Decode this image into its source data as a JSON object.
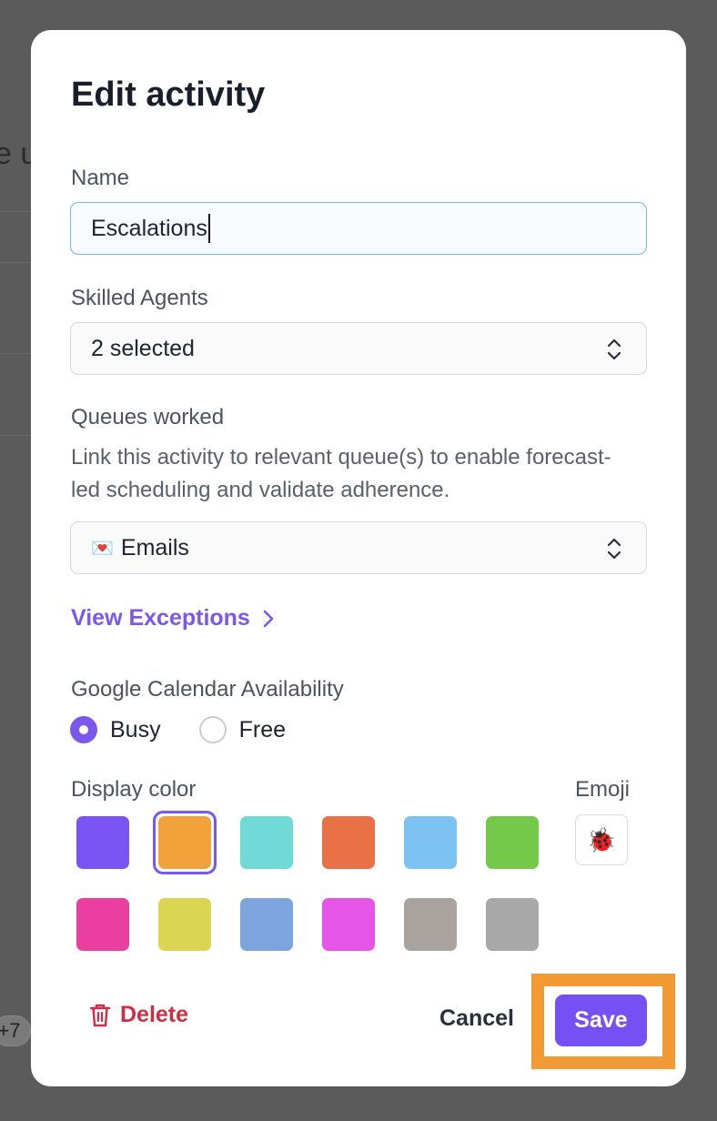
{
  "background": {
    "partial_text": "e u",
    "pill_text": "+7"
  },
  "modal": {
    "title": "Edit activity",
    "name": {
      "label": "Name",
      "value": "Escalations"
    },
    "skilled_agents": {
      "label": "Skilled Agents",
      "value": "2 selected"
    },
    "queues": {
      "label": "Queues worked",
      "help": "Link this activity to relevant queue(s) to enable forecast-led scheduling and validate adherence.",
      "value_emoji": "💌",
      "value": "Emails"
    },
    "view_exceptions": "View Exceptions",
    "availability": {
      "label": "Google Calendar Availability",
      "options": [
        "Busy",
        "Free"
      ],
      "selected": "Busy"
    },
    "display_color": {
      "label": "Display color",
      "selected": "#f2a23a",
      "colors_row1": [
        "#7a55f3",
        "#f2a23a",
        "#6fdad6",
        "#e87146",
        "#7cc3f3",
        "#75c94a"
      ],
      "colors_row2": [
        "#ea3ea0",
        "#dcd553",
        "#7ca4dd",
        "#e555e8",
        "#a9a3a0",
        "#a8a8a8"
      ]
    },
    "emoji": {
      "label": "Emoji",
      "value": "🐞"
    },
    "footer": {
      "delete_label": "Delete",
      "cancel_label": "Cancel",
      "save_label": "Save"
    },
    "accent": "#7b57ee",
    "danger": "#d22c45",
    "highlight": "#f29a33"
  }
}
